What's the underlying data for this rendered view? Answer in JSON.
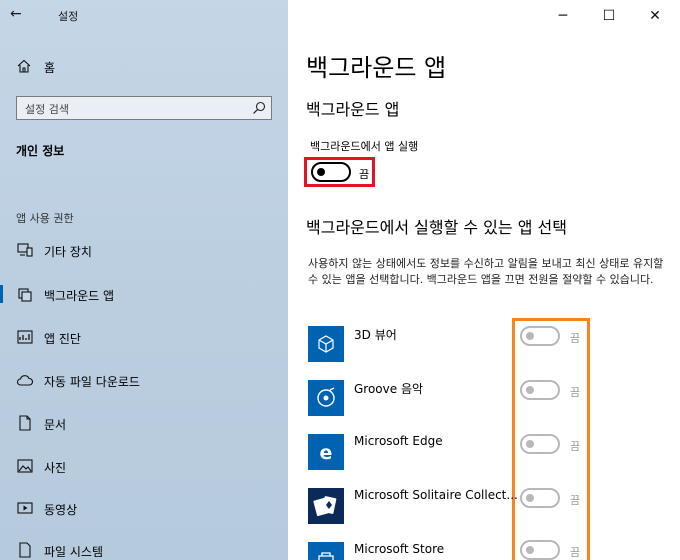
{
  "window": {
    "title": "설정",
    "back": "←",
    "minimize": "─",
    "maximize": "☐",
    "close": "✕"
  },
  "sidebar": {
    "home": "홈",
    "search": {
      "placeholder": "설정 검색"
    },
    "section_title": "개인 정보",
    "group_header": "앱 사용 권한",
    "items": [
      {
        "label": "기타 장치",
        "icon": "devices-icon"
      },
      {
        "label": "백그라운드 앱",
        "icon": "background-apps-icon",
        "selected": true
      },
      {
        "label": "앱 진단",
        "icon": "diagnostics-icon"
      },
      {
        "label": "자동 파일 다운로드",
        "icon": "cloud-icon"
      },
      {
        "label": "문서",
        "icon": "document-icon"
      },
      {
        "label": "사진",
        "icon": "picture-icon"
      },
      {
        "label": "동영상",
        "icon": "video-icon"
      },
      {
        "label": "파일 시스템",
        "icon": "file-system-icon"
      }
    ]
  },
  "main": {
    "page_title": "백그라운드 앱",
    "subtitle": "백그라운드 앱",
    "toggle_caption": "백그라운드에서 앱 실행",
    "master_toggle": {
      "state": "끔",
      "on": false
    },
    "section_title": "백그라운드에서 실행할 수 있는 앱 선택",
    "description": "사용하지 않는 상태에서도 정보를 수신하고 알림을 보내고 최신 상태로 유지할 수 있는 앱을 선택합니다. 백그라운드 앱을 끄면 전원을 절약할 수 있습니다.",
    "apps": [
      {
        "name": "3D 뷰어",
        "state": "끔",
        "icon": "3d-viewer-icon"
      },
      {
        "name": "Groove 음악",
        "state": "끔",
        "icon": "groove-music-icon"
      },
      {
        "name": "Microsoft Edge",
        "state": "끔",
        "icon": "edge-icon"
      },
      {
        "name": "Microsoft Solitaire Collect...",
        "state": "끔",
        "icon": "solitaire-icon"
      },
      {
        "name": "Microsoft Store",
        "state": "끔",
        "icon": "store-icon"
      }
    ]
  },
  "colors": {
    "accent": "#0063b1",
    "highlight_red": "#e81123",
    "highlight_orange": "#f7851e"
  }
}
